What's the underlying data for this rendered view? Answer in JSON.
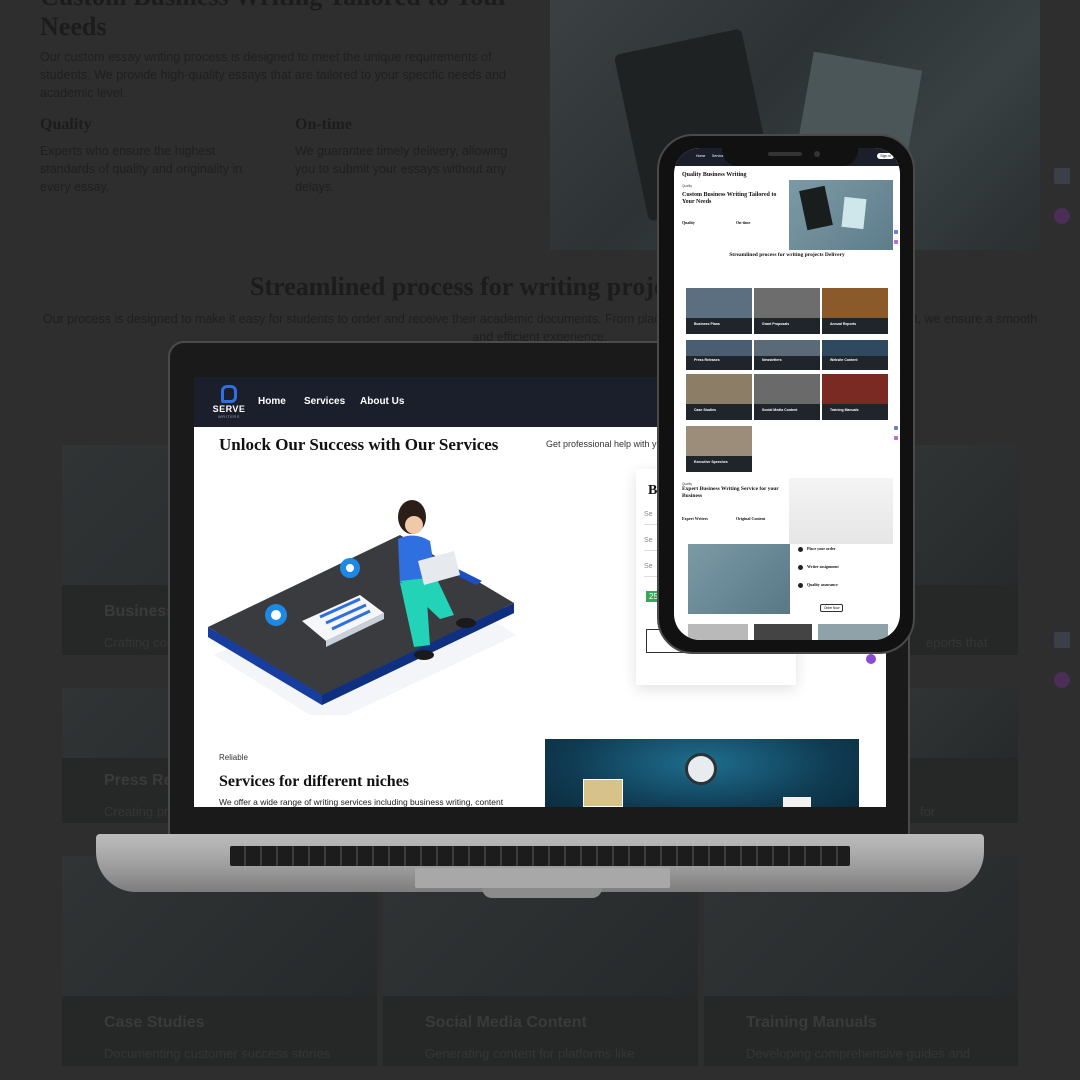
{
  "background": {
    "heading": "Custom Business Writing Tailored to Your Needs",
    "paragraph": "Our custom essay writing process is designed to meet the unique requirements of students. We provide high-quality essays that are tailored to your specific needs and academic level.",
    "columns": [
      {
        "title": "Quality",
        "text": "Experts who ensure the highest standards of quality and originality in every essay."
      },
      {
        "title": "On-time",
        "text": "We guarantee timely delivery, allowing you to submit your essays without any delays."
      }
    ],
    "process_title": "Streamlined process for writing projects Delivery",
    "process_text": "Our process is designed to make it easy for students to order and receive their academic documents. From placing your order to receiving your final document, we ensure a smooth and efficient experience.",
    "cards": [
      {
        "title": "Business Plans",
        "desc": "Crafting comprehensive business plans"
      },
      {
        "title": "Press Releases",
        "desc": "Creating press releases for announcements"
      },
      {
        "title": "Case Studies",
        "desc": "Documenting customer success stories"
      },
      {
        "title": "Social Media Content",
        "desc": "Generating content for platforms like"
      },
      {
        "title": "Training Manuals",
        "desc": "Developing comprehensive guides and"
      }
    ],
    "right_fragments": [
      "eports that",
      "for"
    ]
  },
  "laptop": {
    "brand": {
      "name": "SERVE",
      "sub": "WRITERS"
    },
    "nav": [
      "Home",
      "Services",
      "About Us"
    ],
    "hero_title": "Unlock Our Success with Our Services",
    "hero_right": "Get professional help with you",
    "form": {
      "heading": "B",
      "fields": [
        "Se",
        "Se",
        "Se"
      ],
      "number": "25"
    },
    "section_eyebrow": "Reliable",
    "section_title": "Services for different niches",
    "section_text": "We offer a wide range of writing services including business writing, content"
  },
  "phone": {
    "nav": [
      "Home",
      "Services"
    ],
    "signin": "Sign in",
    "h1": "Quality Business Writing",
    "eyebrow": "Quality",
    "h2": "Custom Business Writing Tailored to Your Needs",
    "col_titles": [
      "Quality",
      "On-time"
    ],
    "h3": "Streamlined process for writing projects Delivery",
    "tiles": [
      "Business Plans",
      "Grant Proposals",
      "Annual Reports",
      "Press Releases",
      "Newsletters",
      "Website Content",
      "Case Studies",
      "Social Media Content",
      "Training Manuals",
      "Executive Speeches"
    ],
    "expert_eyebrow": "Quality",
    "expert_title": "Expert Business Writing Service for your Business",
    "expert_cols": [
      "Expert Writers",
      "Original Content"
    ],
    "steps": [
      "Place your order",
      "Writer assignment",
      "Quality assurance"
    ],
    "order_btn": "Order Now"
  },
  "colors": {
    "nav_bg": "#1b1f2b",
    "accent_blue": "#2f6fe0",
    "accent_green": "#3aa65b",
    "illustration_teal": "#22d3b8"
  }
}
